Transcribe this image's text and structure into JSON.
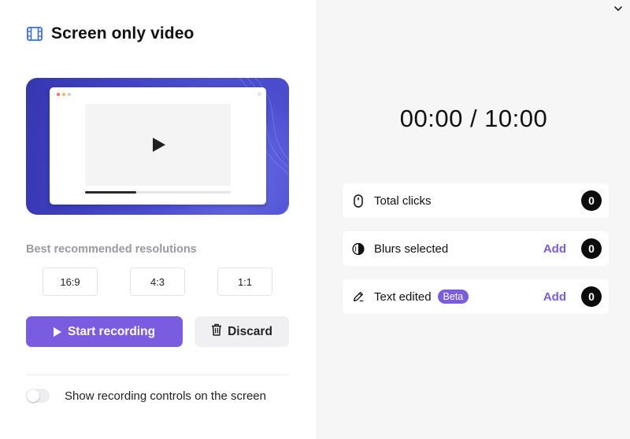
{
  "header": {
    "title": "Screen only video",
    "icon": "film-icon"
  },
  "preview": {
    "progress_fraction": 0.35
  },
  "resolutions": {
    "label": "Best recommended resolutions",
    "options": [
      "16:9",
      "4:3",
      "1:1"
    ]
  },
  "actions": {
    "start_label": "Start recording",
    "discard_label": "Discard"
  },
  "toggle": {
    "label": "Show recording controls on the screen",
    "on": false
  },
  "timer": {
    "text": "00:00 / 10:00"
  },
  "stats": {
    "clicks": {
      "label": "Total clicks",
      "count": "0",
      "icon": "mouse-icon"
    },
    "blurs": {
      "label": "Blurs selected",
      "add": "Add",
      "count": "0",
      "icon": "blur-icon"
    },
    "text": {
      "label": "Text edited",
      "badge": "Beta",
      "add": "Add",
      "count": "0",
      "icon": "pen-icon"
    }
  },
  "colors": {
    "accent": "#7a5ce0",
    "preview_bg": "#4c4fd0",
    "panel_bg": "#f6f6f7"
  }
}
